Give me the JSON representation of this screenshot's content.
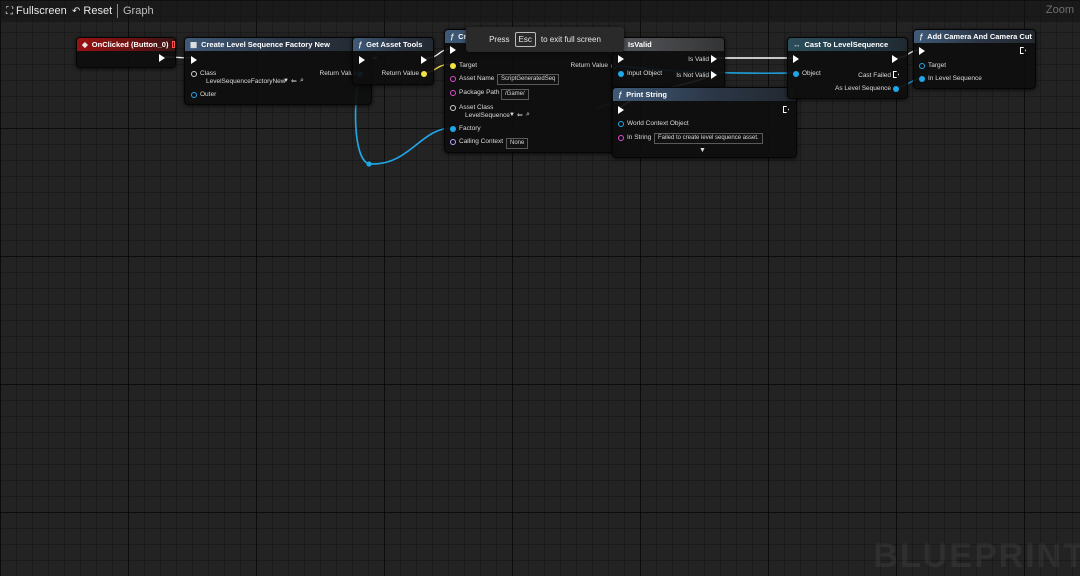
{
  "toolbar": {
    "fullscreen_label": "Fullscreen",
    "reset_label": "Reset",
    "graph_label": "Graph",
    "zoom_label": "Zoom"
  },
  "watermark": "BLUEPRINT",
  "overlay": {
    "press": "Press",
    "key": "Esc",
    "message": "to exit full screen"
  },
  "nodes": {
    "onclicked": {
      "title": "OnClicked (Button_0)"
    },
    "create_factory": {
      "title": "Create Level Sequence Factory New",
      "class_label": "Class",
      "class_value": "LevelSequenceFactoryNew",
      "outer_label": "Outer",
      "return_label": "Return Value"
    },
    "get_asset_tools": {
      "title": "Get Asset Tools",
      "return_label": "Return Value"
    },
    "create_asset": {
      "title": "Create Asset",
      "target_label": "Target",
      "asset_name_label": "Asset Name",
      "asset_name_value": "ScriptGeneratedSeq",
      "package_path_label": "Package Path",
      "package_path_value": "/Game/",
      "asset_class_label": "Asset Class",
      "asset_class_value": "LevelSequence",
      "factory_label": "Factory",
      "calling_context_label": "Calling Context",
      "calling_context_value": "None",
      "return_label": "Return Value"
    },
    "isvalid": {
      "title": "IsValid",
      "input_label": "Input Object",
      "is_valid_label": "Is Valid",
      "is_not_valid_label": "Is Not Valid"
    },
    "print_string": {
      "title": "Print String",
      "world_context_label": "World Context Object",
      "in_string_label": "In String",
      "in_string_value": "Failed to create level sequence asset."
    },
    "cast": {
      "title": "Cast To LevelSequence",
      "object_label": "Object",
      "cast_failed_label": "Cast Failed",
      "as_label": "As Level Sequence"
    },
    "add_camera": {
      "title": "Add Camera And Camera Cut",
      "target_label": "Target",
      "in_level_sequence_label": "In Level Sequence"
    }
  },
  "colors": {
    "background": "#232323",
    "exec_wire": "#ffffff",
    "object_wire": "#1fa8e8",
    "struct_wire": "#f5e048",
    "event_header": "#9a1212",
    "function_header": "#3f5a78"
  }
}
